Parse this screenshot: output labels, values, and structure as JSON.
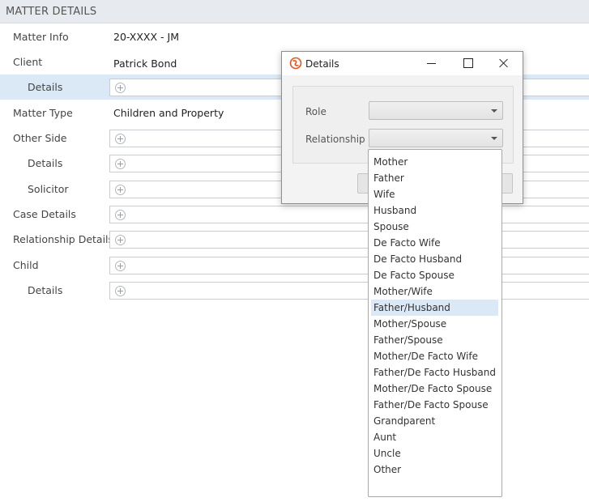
{
  "header": {
    "title": "MATTER DETAILS"
  },
  "rows": [
    {
      "label": "Matter Info",
      "value": "20-XXXX - JM"
    },
    {
      "label": "Client",
      "value": "Patrick Bond"
    },
    {
      "label": "Details"
    },
    {
      "label": "Matter Type",
      "value": "Children and Property"
    },
    {
      "label": "Other Side"
    },
    {
      "label": "Details"
    },
    {
      "label": "Solicitor"
    },
    {
      "label": "Case Details"
    },
    {
      "label": "Relationship Details"
    },
    {
      "label": "Child"
    },
    {
      "label": "Details"
    }
  ],
  "dialog": {
    "title": "Details",
    "role_label": "Role",
    "role_value": "",
    "relationship_label": "Relationship",
    "relationship_value": ""
  },
  "relationship_options": [
    "Mother",
    "Father",
    "Wife",
    "Husband",
    "Spouse",
    "De Facto Wife",
    "De Facto Husband",
    "De Facto Spouse",
    "Mother/Wife",
    "Father/Husband",
    "Mother/Spouse",
    "Father/Spouse",
    "Mother/De Facto Wife",
    "Father/De Facto Husband",
    "Mother/De Facto Spouse",
    "Father/De Facto Spouse",
    "Grandparent",
    "Aunt",
    "Uncle",
    "Other"
  ],
  "highlighted_option": "Father/Husband",
  "colors": {
    "selection": "#dbe9f6",
    "header_bg": "#e7eaee",
    "app_icon": "#e8541e"
  }
}
